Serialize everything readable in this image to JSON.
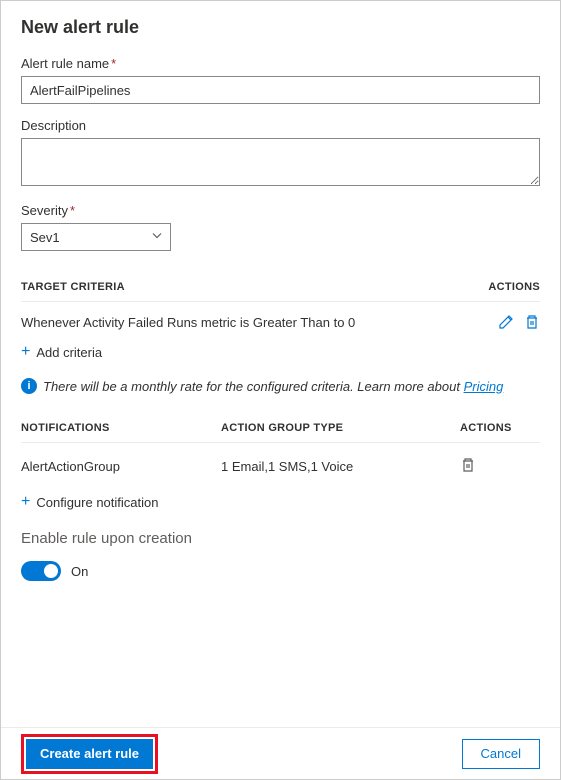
{
  "title": "New alert rule",
  "fields": {
    "name_label": "Alert rule name",
    "name_value": "AlertFailPipelines",
    "desc_label": "Description",
    "desc_value": "",
    "severity_label": "Severity",
    "severity_value": "Sev1"
  },
  "target": {
    "heading": "TARGET CRITERIA",
    "actions_heading": "ACTIONS",
    "criteria_text": "Whenever Activity Failed Runs metric is Greater Than to 0",
    "add_label": "Add criteria"
  },
  "info": {
    "text": "There will be a monthly rate for the configured criteria. Learn more about",
    "link": "Pricing"
  },
  "notifications": {
    "heading_notif": "NOTIFICATIONS",
    "heading_action_group": "ACTION GROUP TYPE",
    "heading_actions": "ACTIONS",
    "row_name": "AlertActionGroup",
    "row_type": "1 Email,1 SMS,1 Voice",
    "configure_label": "Configure notification"
  },
  "enable": {
    "heading": "Enable rule upon creation",
    "state": "On"
  },
  "footer": {
    "create": "Create alert rule",
    "cancel": "Cancel"
  }
}
